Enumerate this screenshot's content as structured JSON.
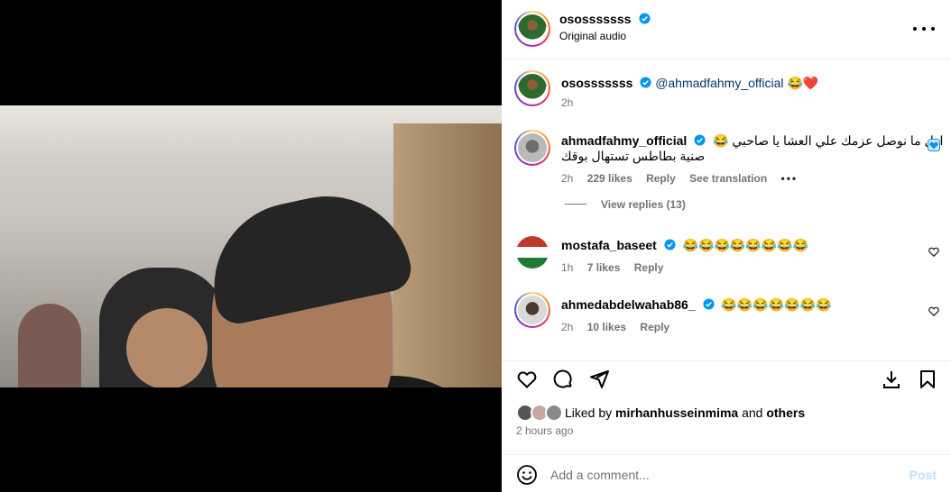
{
  "header": {
    "username": "ososssssss",
    "subtitle": "Original audio",
    "more_icon": "more-horizontal-icon"
  },
  "caption": {
    "username": "ososssssss",
    "mention": "@ahmadfahmy_official",
    "emojis": "😂❤️",
    "time": "2h"
  },
  "comments": [
    {
      "username": "ahmadfahmy_official",
      "text_line1": "اول ما نوصل عزمك علي العشا يا صاحبي 😂",
      "text_line2": "صنية بطاطس تستهال بوقك",
      "time": "2h",
      "likes": "229 likes",
      "reply": "Reply",
      "translate": "See translation",
      "liked_by_author": true,
      "view_replies": "View replies (13)"
    },
    {
      "username": "mostafa_baseet",
      "text": "😂😂😂😂😂😂😂😂",
      "time": "1h",
      "likes": "7 likes",
      "reply": "Reply"
    },
    {
      "username": "ahmedabdelwahab86_",
      "text": "😂😂😂😂😂😂😂",
      "time": "2h",
      "likes": "10 likes",
      "reply": "Reply"
    }
  ],
  "likes": {
    "prefix": "Liked by",
    "user": "mirhanhusseinmima",
    "and": "and",
    "others": "others",
    "time_ago": "2 hours ago"
  },
  "add_comment": {
    "placeholder": "Add a comment...",
    "post_label": "Post"
  },
  "colors": {
    "link": "#00376b",
    "verified": "#0095f6",
    "muted": "#737373",
    "like_red": "#ff3040",
    "post_disabled": "#c0dffd"
  }
}
